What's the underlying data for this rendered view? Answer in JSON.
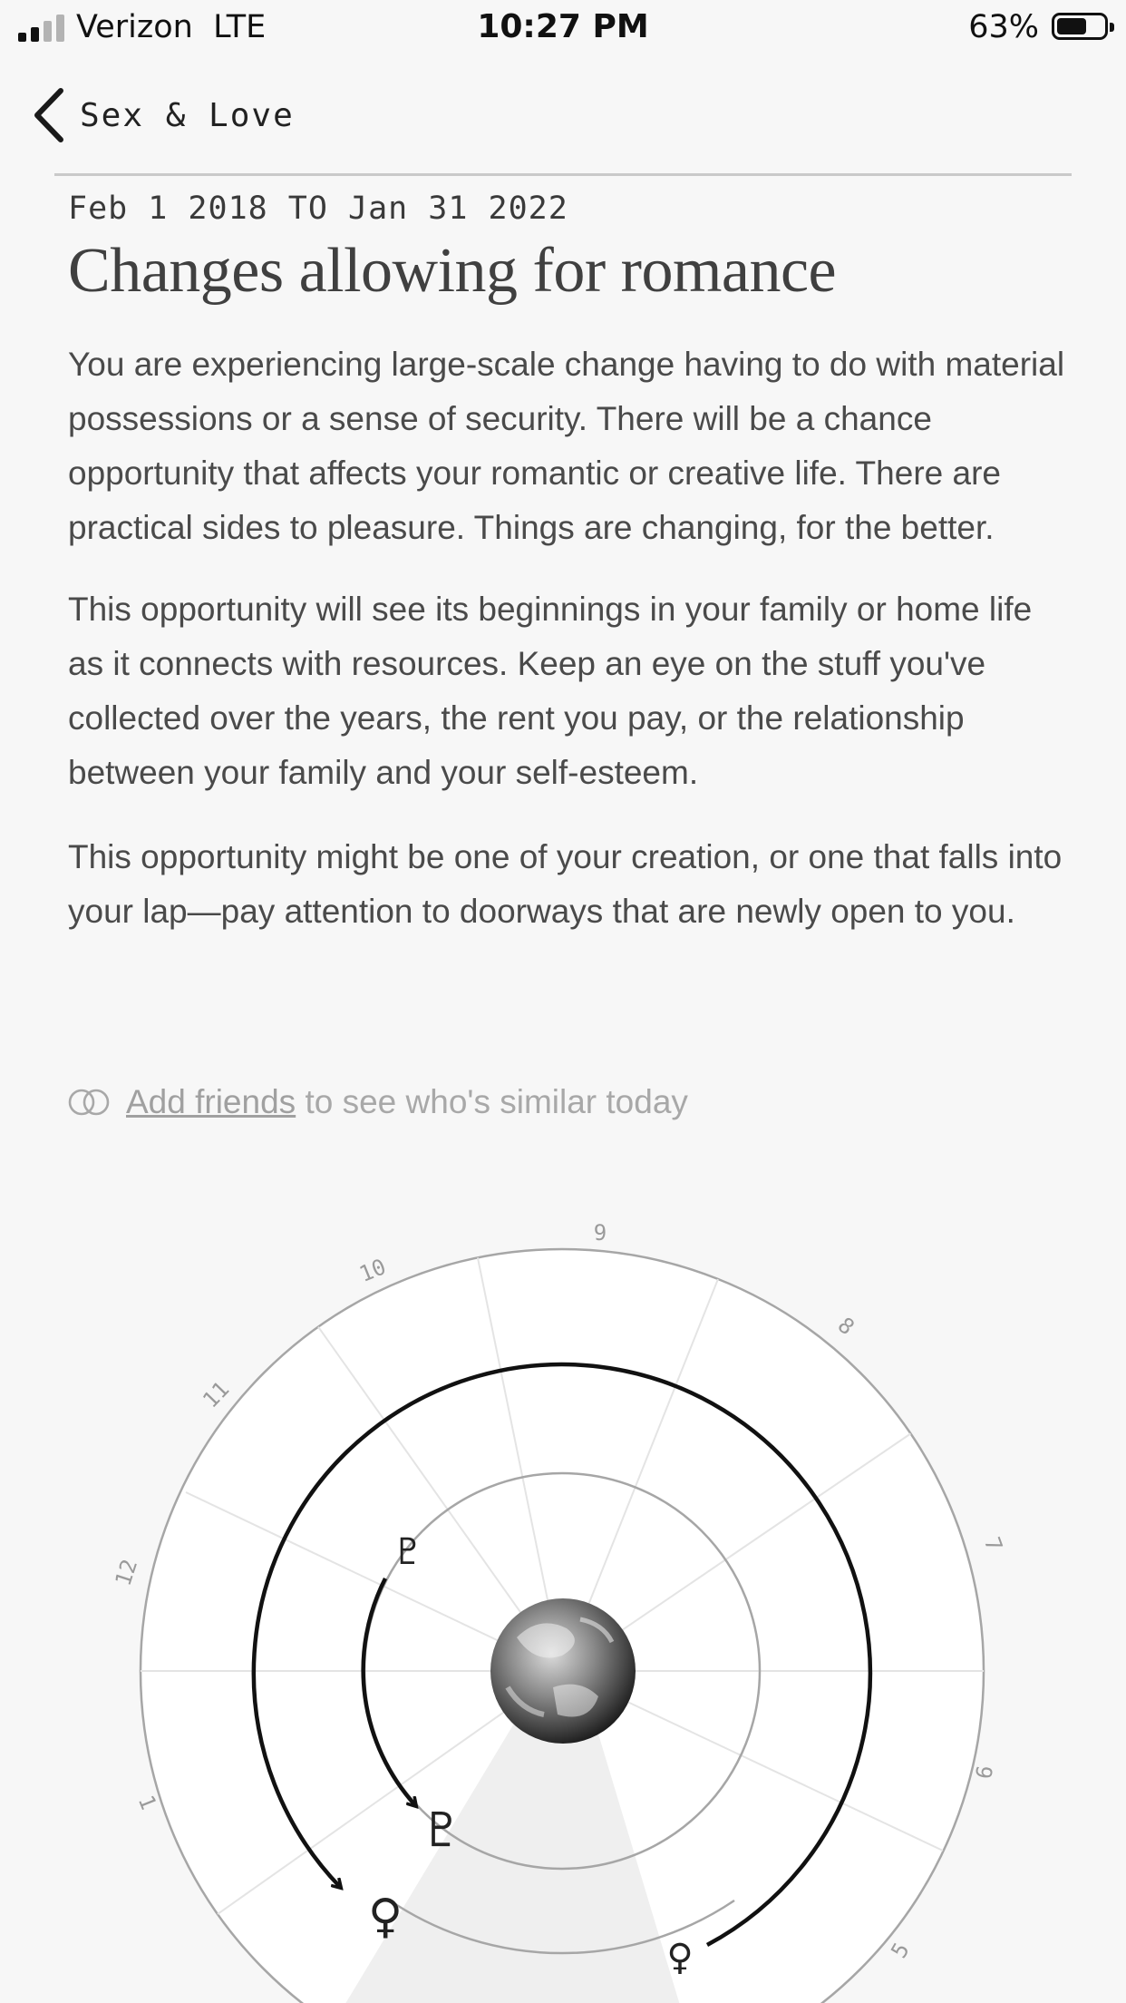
{
  "status_bar": {
    "carrier": "Verizon",
    "network": "LTE",
    "time": "10:27 PM",
    "battery": "63%",
    "battery_level": 0.63,
    "signal_bars_active": 2,
    "signal_bars_total": 4
  },
  "nav": {
    "back_icon": "chevron-left-icon",
    "title": "Sex & Love"
  },
  "article": {
    "date_range": "Feb 1 2018 TO Jan 31 2022",
    "title": "Changes allowing for romance",
    "paragraphs": [
      "You are experiencing large-scale change having to do with material possessions or a sense of security. There will be a chance opportunity that affects your romantic or creative life. There are practical sides to pleasure. Things are changing, for the better.",
      "This opportunity will see its beginnings in your family or home life as it connects with resources. Keep an eye on the stuff you've collected over the years, the rent you pay, or the relationship between your family and your self-esteem.",
      "This opportunity might be one of your creation, or one that falls into your lap—pay attention to doorways that are newly open to you."
    ]
  },
  "friends_prompt": {
    "icon": "overlapping-circles-icon",
    "link_text": "Add friends",
    "rest_text": " to see who's similar today"
  },
  "chart_wheel": {
    "center_icon": "earth-icon",
    "house_labels": [
      "9",
      "10",
      "8",
      "11",
      "7",
      "12",
      "6",
      "1",
      "5"
    ],
    "planets": {
      "pluto_glyph": "♇",
      "venus_glyph": "♀"
    },
    "colors": {
      "background": "#f7f7f7",
      "wheel_fill": "#ffffff",
      "ring_stroke": "#a6a6a6",
      "arc_stroke": "#111111",
      "highlight": "#efefef"
    }
  }
}
